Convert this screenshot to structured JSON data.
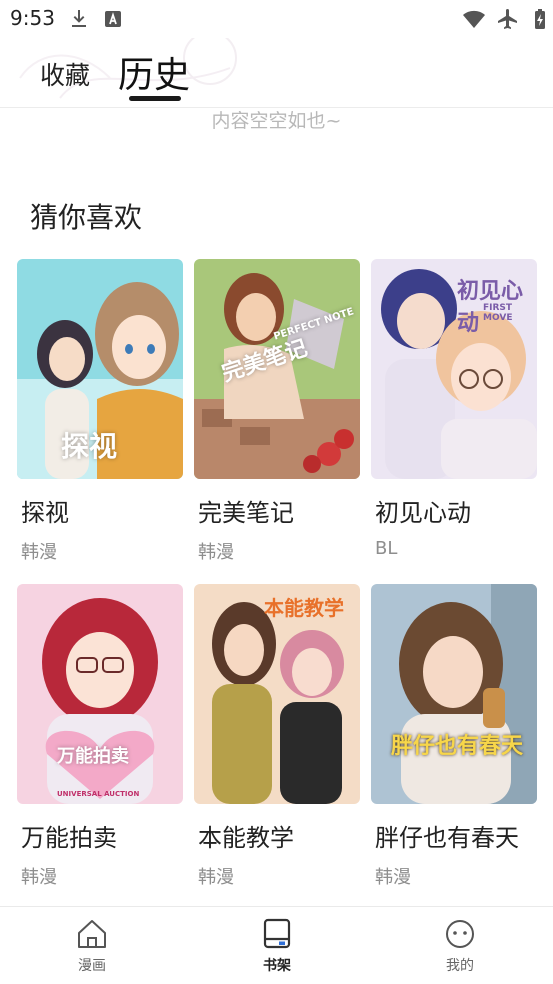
{
  "status_bar": {
    "time": "9:53",
    "icons": [
      "download-icon",
      "font-a-icon",
      "wifi-icon",
      "airplane-icon",
      "battery-icon"
    ]
  },
  "header": {
    "tabs": [
      {
        "label": "收藏",
        "active": false
      },
      {
        "label": "历史",
        "active": true
      }
    ]
  },
  "empty_state": "内容空空如也~",
  "recommend": {
    "title": "猜你喜欢",
    "items": [
      {
        "title": "探视",
        "tag": "韩漫",
        "cover_text": "探视",
        "cover_colors": [
          "#7fd6e0",
          "#f4d9b8"
        ]
      },
      {
        "title": "完美笔记",
        "tag": "韩漫",
        "cover_text": "完美笔记",
        "cover_subtext": "PERFECT NOTE",
        "cover_colors": [
          "#9bbf6a",
          "#c9826a"
        ]
      },
      {
        "title": "初见心动",
        "tag": "BL",
        "cover_text": "初见心动",
        "cover_subtext": "FIRST MOVE",
        "cover_colors": [
          "#c9b9e6",
          "#f2d6c8"
        ]
      },
      {
        "title": "万能拍卖",
        "tag": "韩漫",
        "cover_text": "万能拍卖",
        "cover_subtext": "UNIVERSAL AUCTION",
        "cover_colors": [
          "#f3c6d8",
          "#c93a4a"
        ]
      },
      {
        "title": "本能教学",
        "tag": "韩漫",
        "cover_text": "本能教学",
        "cover_colors": [
          "#f2d4b6",
          "#e8a9b8"
        ]
      },
      {
        "title": "胖仔也有春天",
        "tag": "韩漫",
        "cover_text": "胖仔也有春天",
        "cover_colors": [
          "#b7c9d8",
          "#d9b48c"
        ]
      }
    ]
  },
  "bottom_nav": {
    "items": [
      {
        "label": "漫画",
        "icon": "home-icon",
        "active": false
      },
      {
        "label": "书架",
        "icon": "bookshelf-icon",
        "active": true
      },
      {
        "label": "我的",
        "icon": "profile-face-icon",
        "active": false
      }
    ],
    "accent": "#2f6fd6"
  }
}
